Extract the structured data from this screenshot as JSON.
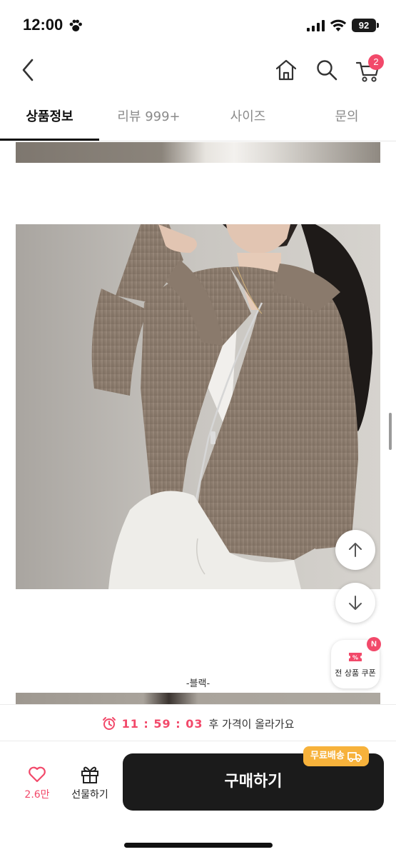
{
  "status_bar": {
    "time": "12:00",
    "battery": "92"
  },
  "nav": {
    "cart_count": "2"
  },
  "tabs": [
    {
      "label": "상품정보",
      "active": true
    },
    {
      "label": "리뷰 999+",
      "active": false
    },
    {
      "label": "사이즈",
      "active": false
    },
    {
      "label": "문의",
      "active": false
    }
  ],
  "product": {
    "caption": "-블랙-"
  },
  "coupon": {
    "label": "전 상품 쿠폰",
    "new_badge": "N"
  },
  "timer": {
    "value": "11 : 59 : 03",
    "text": "후 가격이 올라가요"
  },
  "bottom": {
    "like_count": "2.6만",
    "gift_label": "선물하기",
    "buy_label": "구매하기",
    "free_shipping": "무료배송"
  },
  "colors": {
    "accent_pink": "#f2496a",
    "buy_button": "#1b1b1b",
    "free_ship": "#f7b23b"
  }
}
